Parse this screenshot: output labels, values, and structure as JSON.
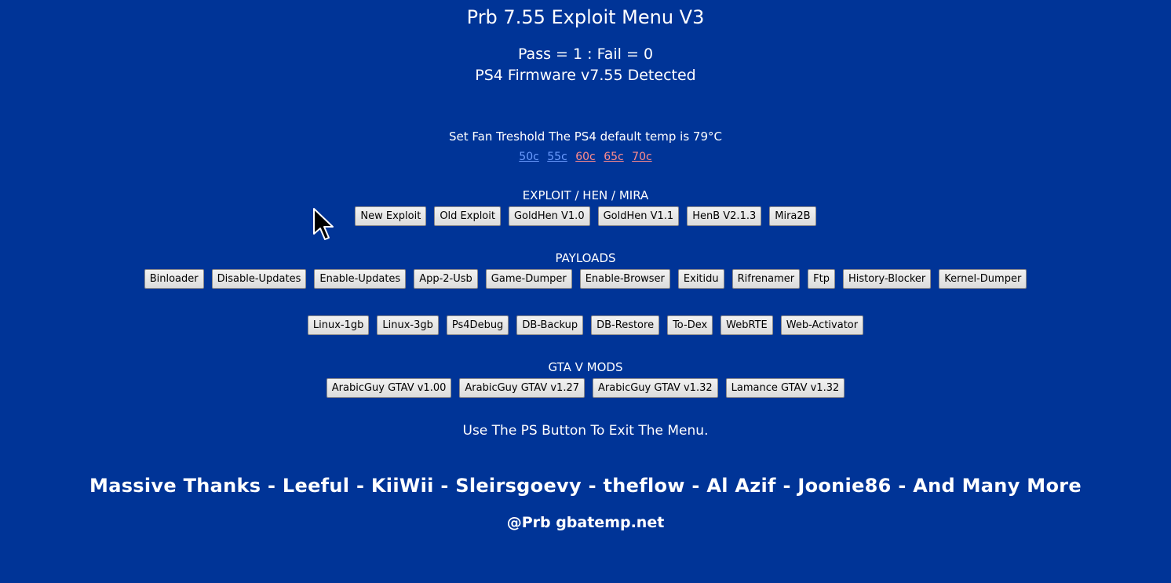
{
  "title": "Prb 7.55 Exploit Menu V3",
  "status": {
    "pass_fail": "Pass = 1  :  Fail = 0",
    "firmware": "PS4 Firmware v7.55 Detected"
  },
  "fan": {
    "title": "Set Fan Treshold The PS4 default temp is 79°C",
    "options": [
      {
        "label": "50c",
        "color": "#6b9cff"
      },
      {
        "label": "55c",
        "color": "#6b9cff"
      },
      {
        "label": "60c",
        "color": "#ff8c8c"
      },
      {
        "label": "65c",
        "color": "#ff8c8c"
      },
      {
        "label": "70c",
        "color": "#ff8c8c"
      }
    ]
  },
  "exploit": {
    "heading": "EXPLOIT / HEN / MIRA",
    "buttons": [
      "New Exploit",
      "Old Exploit",
      "GoldHen V1.0",
      "GoldHen V1.1",
      "HenB V2.1.3",
      "Mira2B"
    ]
  },
  "payloads": {
    "heading": "PAYLOADS",
    "row1": [
      "Binloader",
      "Disable-Updates",
      "Enable-Updates",
      "App-2-Usb",
      "Game-Dumper",
      "Enable-Browser",
      "Exitidu",
      "Rifrenamer",
      "Ftp",
      "History-Blocker",
      "Kernel-Dumper"
    ],
    "row2": [
      "Linux-1gb",
      "Linux-3gb",
      "Ps4Debug",
      "DB-Backup",
      "DB-Restore",
      "To-Dex",
      "WebRTE",
      "Web-Activator"
    ]
  },
  "gta": {
    "heading": "GTA V MODS",
    "buttons": [
      "ArabicGuy GTAV v1.00",
      "ArabicGuy GTAV v1.27",
      "ArabicGuy GTAV v1.32",
      "Lamance GTAV v1.32"
    ]
  },
  "exit_note": "Use The PS Button To Exit The Menu.",
  "thanks": "Massive Thanks - Leeful - KiiWii - Sleirsgoevy - theflow - Al Azif - Joonie86 - And Many More",
  "credit": "@Prb gbatemp.net",
  "colors": {
    "background": "#003497",
    "text": "#ffffff",
    "button_bg": "#e6e6e6",
    "link_cool": "#6b9cff",
    "link_warm": "#ff8c8c"
  },
  "icons": {
    "cursor": "mouse-pointer-icon"
  }
}
